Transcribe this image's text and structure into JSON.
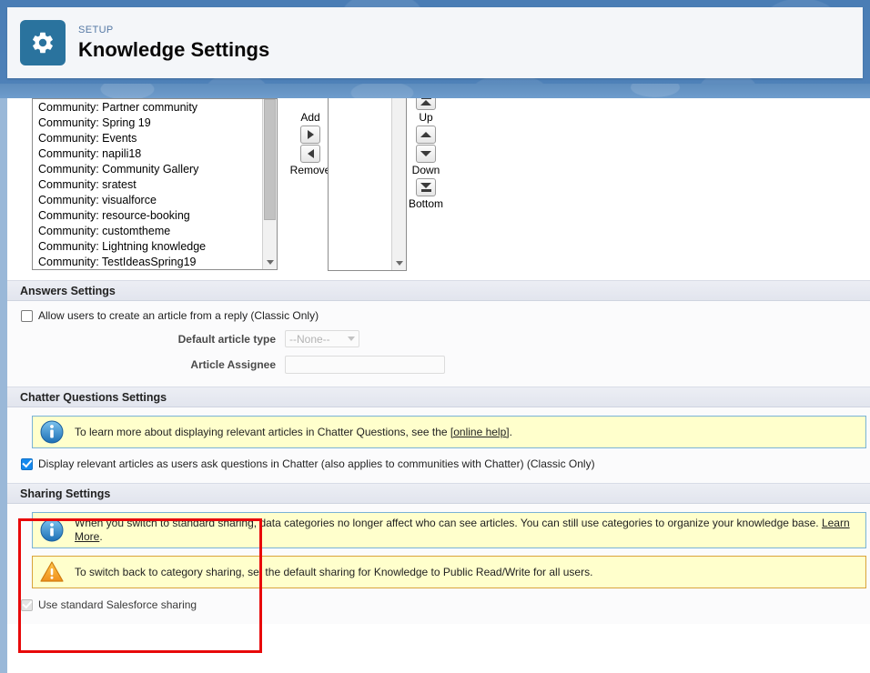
{
  "header": {
    "eyebrow": "SETUP",
    "title": "Knowledge Settings",
    "icon": "gear-icon"
  },
  "picker": {
    "available_items": [
      "Community: Partner community",
      "Community: Spring 19",
      "Community: Events",
      "Community: napili18",
      "Community: Community Gallery",
      "Community: sratest",
      "Community: visualforce",
      "Community: resource-booking",
      "Community: customtheme",
      "Community: Lightning knowledge",
      "Community: TestIdeasSpring19"
    ],
    "selected_items": [],
    "add_label": "Add",
    "remove_label": "Remove",
    "up_label": "Up",
    "down_label": "Down",
    "bottom_label": "Bottom",
    "add_icon": "arrow-right-icon",
    "remove_icon": "arrow-left-icon",
    "top_icon": "move-to-top-icon",
    "up_icon": "move-up-icon",
    "down_icon": "move-down-icon",
    "bottom_icon": "move-to-bottom-icon"
  },
  "answers_settings": {
    "header": "Answers Settings",
    "allow_article_from_reply": {
      "label": "Allow users to create an article from a reply (Classic Only)",
      "checked": false
    },
    "default_article_type": {
      "label": "Default article type",
      "value": "--None--",
      "disabled": true
    },
    "article_assignee": {
      "label": "Article Assignee",
      "value": "",
      "placeholder": "",
      "disabled": true
    }
  },
  "chatter_questions_settings": {
    "header": "Chatter Questions Settings",
    "info_banner": {
      "icon": "info-icon",
      "text_before": "To learn more about displaying relevant articles in Chatter Questions, see the ",
      "link_text": "[online help]",
      "text_after": "."
    },
    "display_relevant_articles": {
      "label": "Display relevant articles as users ask questions in Chatter (also applies to communities with Chatter) (Classic Only)",
      "checked": true
    }
  },
  "sharing_settings": {
    "header": "Sharing Settings",
    "info_banner": {
      "icon": "info-icon",
      "text_before": "When you switch to standard sharing, data categories no longer affect who can see articles. You can still use categories to organize your knowledge base. ",
      "link_text": "Learn More",
      "text_after": "."
    },
    "warning_banner": {
      "icon": "warning-icon",
      "text": "To switch back to category sharing, set the default sharing for Knowledge to Public Read/Write for all users."
    },
    "use_standard_sharing": {
      "label": "Use standard Salesforce sharing",
      "checked": true,
      "disabled": true
    }
  },
  "annotation": {
    "color": "#e8090a"
  }
}
